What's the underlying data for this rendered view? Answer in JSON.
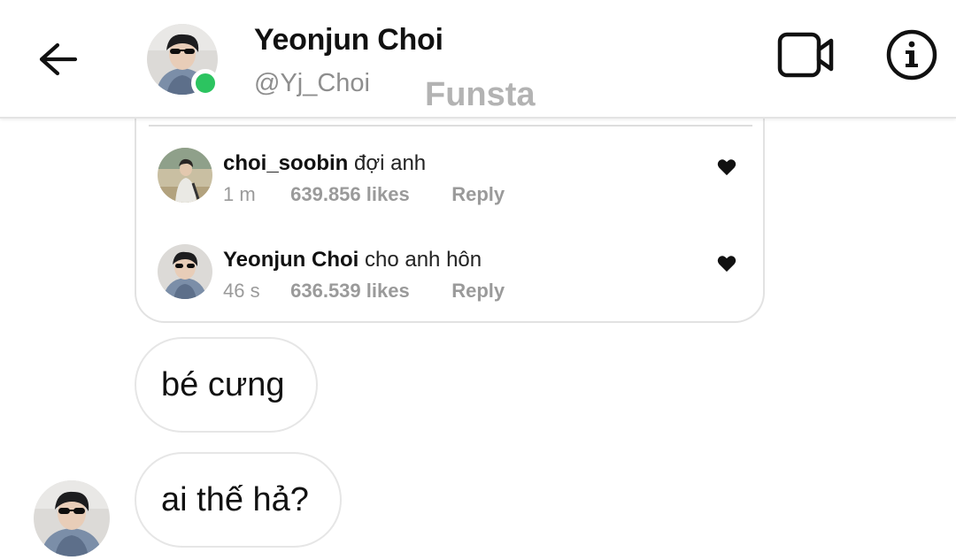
{
  "header": {
    "name": "Yeonjun Choi",
    "handle": "@Yj_Choi",
    "watermark": "Funsta",
    "back_icon": "arrow-left-icon",
    "video_icon": "video-camera-icon",
    "info_icon": "info-icon",
    "online_status_color": "#2cc460"
  },
  "post": {
    "comments": [
      {
        "user": "choi_soobin",
        "text": "đợi anh",
        "time": "1 m",
        "likes": "639.856 likes",
        "reply": "Reply"
      },
      {
        "user": "Yeonjun Choi",
        "text": "cho anh hôn",
        "time": "46 s",
        "likes": "636.539 likes",
        "reply": "Reply"
      }
    ]
  },
  "messages": [
    {
      "text": "bé cưng"
    },
    {
      "text": "ai thế hả?"
    }
  ],
  "colors": {
    "text_primary": "#111111",
    "text_secondary": "#8e8e8e",
    "border": "#e6e6e6"
  }
}
